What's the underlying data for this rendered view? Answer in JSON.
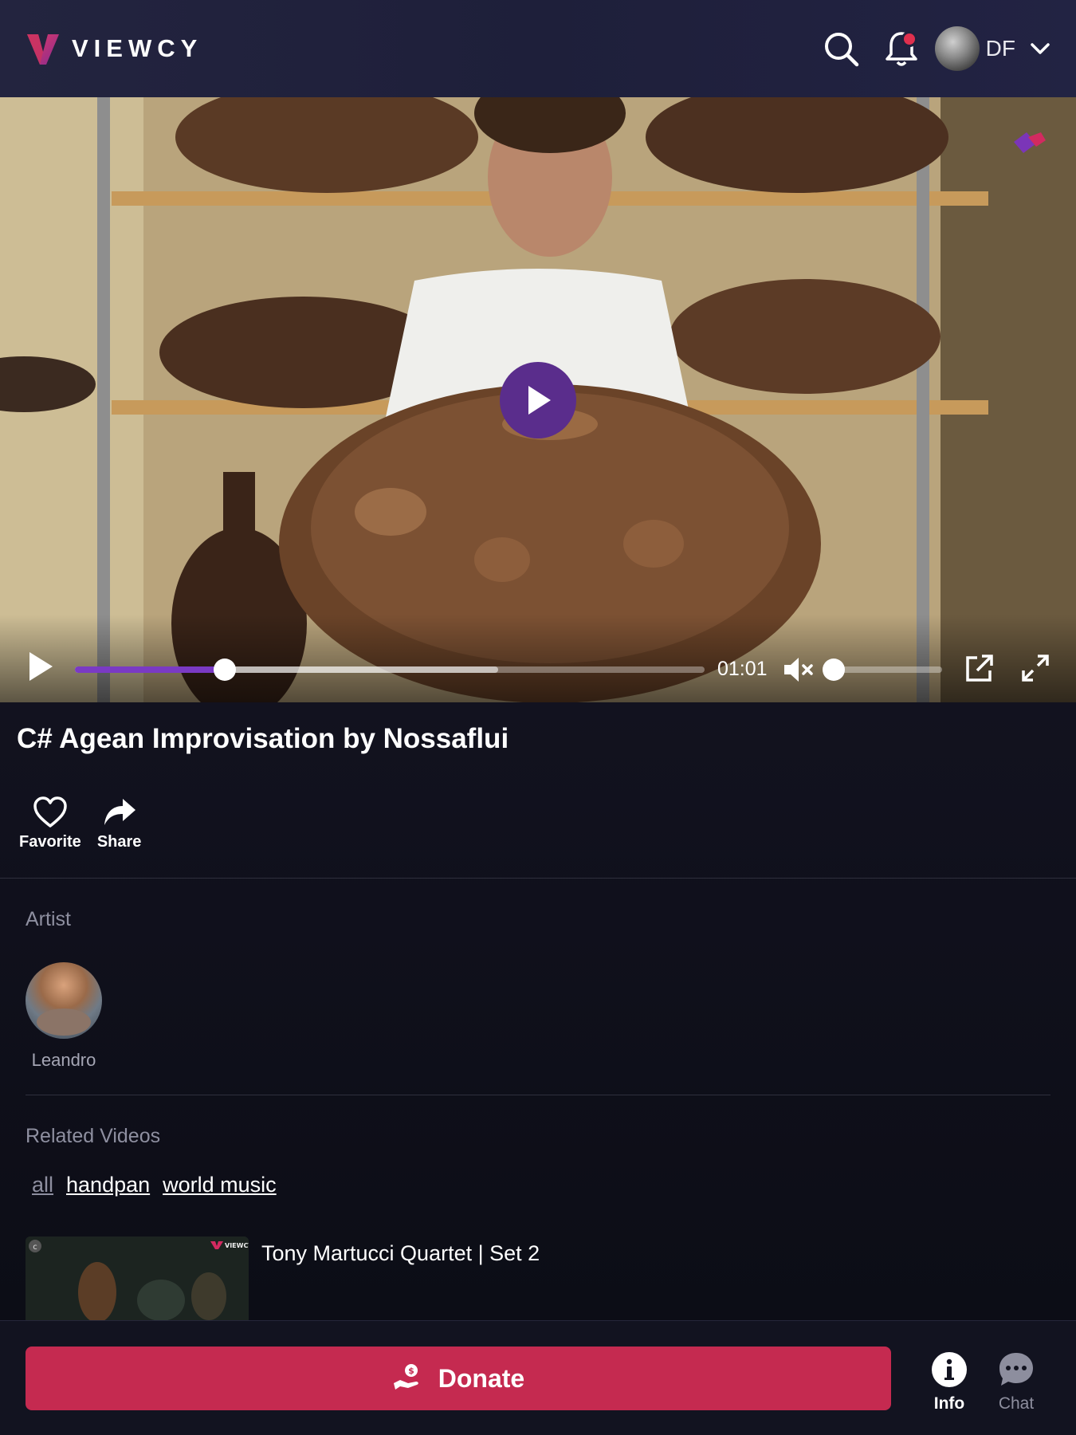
{
  "header": {
    "brand": "VIEWCY",
    "user_initials": "DF",
    "notification_dot_color": "#e0304e"
  },
  "player": {
    "current_time": "01:01",
    "progress_fraction": 0.238,
    "buffered_fraction": 0.672,
    "volume_fraction": 0.0,
    "muted": true,
    "accent_color": "#7a3ac4"
  },
  "video": {
    "title": "C# Agean Improvisation by Nossaflui"
  },
  "actions": {
    "favorite_label": "Favorite",
    "share_label": "Share"
  },
  "artist_section": {
    "label": "Artist",
    "artists": [
      {
        "name": "Leandro"
      }
    ]
  },
  "related": {
    "label": "Related Videos",
    "tags": [
      {
        "label": "all",
        "active": false
      },
      {
        "label": "handpan",
        "active": true
      },
      {
        "label": "world music",
        "active": true
      }
    ],
    "items": [
      {
        "title": "Tony Martucci Quartet | Set 2",
        "thumb_watermark": "VIEWCY",
        "thumb_badge": "c"
      }
    ]
  },
  "bottom_bar": {
    "donate_label": "Donate",
    "donate_color": "#c52a50",
    "tabs": [
      {
        "label": "Info",
        "icon": "info-icon",
        "active": true
      },
      {
        "label": "Chat",
        "icon": "chat-icon",
        "active": false
      }
    ]
  }
}
